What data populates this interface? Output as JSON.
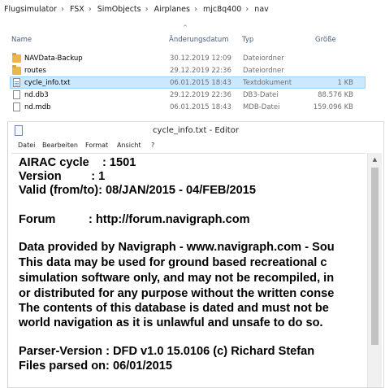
{
  "explorer": {
    "breadcrumb": [
      "Flugsimulator",
      "FSX",
      "SimObjects",
      "Airplanes",
      "mjc8q400",
      "nav"
    ],
    "columns": {
      "name": "Name",
      "date": "Änderungsdatum",
      "type": "Typ",
      "size": "Größe"
    },
    "files": [
      {
        "name": "NAVData-Backup",
        "date": "30.12.2019 12:09",
        "type": "Dateiordner",
        "size": "",
        "icon": "folder-icon"
      },
      {
        "name": "routes",
        "date": "29.12.2019 22:36",
        "type": "Dateiordner",
        "size": "",
        "icon": "folder-icon"
      },
      {
        "name": "cycle_info.txt",
        "date": "06.01.2015 18:43",
        "type": "Textdokument",
        "size": "1 KB",
        "icon": "text-file-icon",
        "selected": true
      },
      {
        "name": "nd.db3",
        "date": "29.12.2019 22:36",
        "type": "DB3-Datei",
        "size": "88.576 KB",
        "icon": "file-icon"
      },
      {
        "name": "nd.mdb",
        "date": "06.01.2015 18:43",
        "type": "MDB-Datei",
        "size": "159.096 KB",
        "icon": "file-icon"
      }
    ]
  },
  "notepad": {
    "title": "cycle_info.txt - Editor",
    "menu": [
      "Datei",
      "Bearbeiten",
      "Format",
      "Ansicht",
      "?"
    ],
    "lines": [
      "AIRAC cycle    : 1501",
      "Version         : 1",
      "Valid (from/to): 08/JAN/2015 - 04/FEB/2015",
      "",
      "Forum          : http://forum.navigraph.com",
      "",
      "Data provided by Navigraph - www.navigraph.com - Sou",
      "This data may be used for ground based recreational c",
      "simulation software only, and may not be recompiled, in",
      "or distributed for any purpose without the written conse",
      "The contents of this database is dated and must not be",
      "world navigation as it is unlawful and unsafe to do so.",
      "",
      "Parser-Version : DFD v1.0 15.0106 (c) Richard Stefan",
      "Files parsed on: 06/01/2015"
    ]
  }
}
